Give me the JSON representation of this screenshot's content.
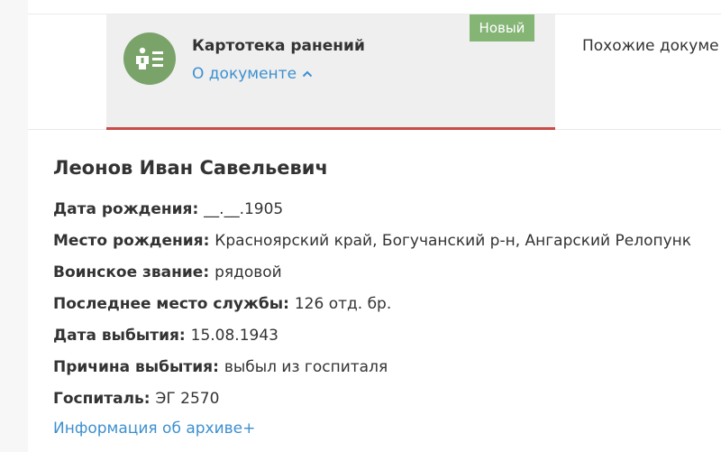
{
  "tabs": {
    "active": {
      "title": "Картотека ранений",
      "about_link": "О документе",
      "badge": "Новый"
    },
    "similar": "Похожие докуме"
  },
  "person": {
    "name": "Леонов Иван Савельевич",
    "fields": [
      {
        "label": "Дата рождения:",
        "value": "__.__.1905"
      },
      {
        "label": "Место рождения:",
        "value": "Красноярский край, Богучанский р-н, Ангарский Релопунк"
      },
      {
        "label": "Воинское звание:",
        "value": "рядовой"
      },
      {
        "label": "Последнее место службы:",
        "value": "126 отд. бр."
      },
      {
        "label": "Дата выбытия:",
        "value": "15.08.1943"
      },
      {
        "label": "Причина выбытия:",
        "value": "выбыл из госпиталя"
      },
      {
        "label": "Госпиталь:",
        "value": "ЭГ 2570"
      }
    ],
    "archive_link": "Информация об архиве+"
  },
  "colors": {
    "accent_link": "#3d90cf",
    "active_tab_underline": "#c94c48",
    "badge_bg": "#84b575",
    "icon_bg": "#7aa36a"
  },
  "icons": {
    "tab_icon": "person-card-icon",
    "about_chevron": "chevron-up-icon"
  }
}
